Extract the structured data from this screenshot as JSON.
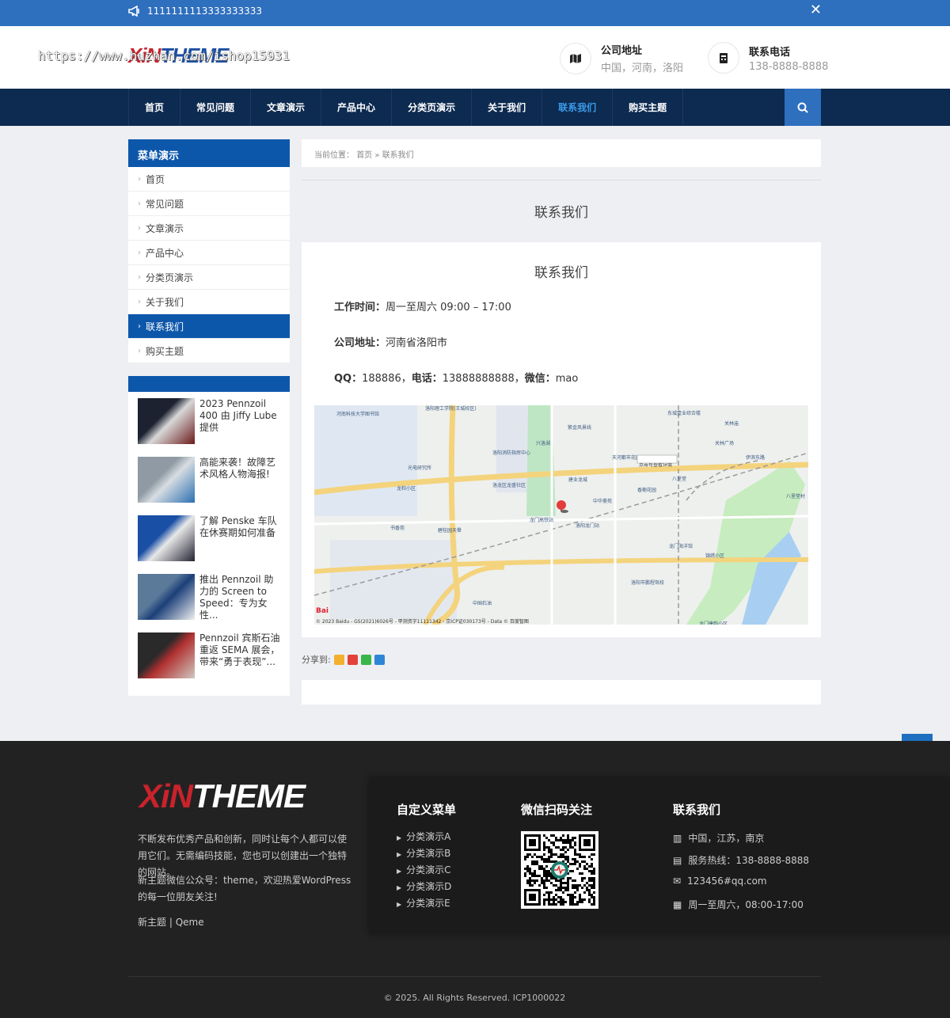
{
  "topbar": {
    "message": "1111111113333333333",
    "close_icon": "close-icon"
  },
  "header": {
    "logo": {
      "part1": "XiN",
      "part2": "THEME"
    },
    "watermark": "https://www.huzhan.com/ishop15931",
    "address": {
      "label": "公司地址",
      "value": "中国，河南，洛阳"
    },
    "phone": {
      "label": "联系电话",
      "value": "138-8888-8888"
    }
  },
  "nav": {
    "items": [
      "首页",
      "常见问题",
      "文章演示",
      "产品中心",
      "分类页演示",
      "关于我们",
      "联系我们",
      "购买主题"
    ],
    "active": "联系我们"
  },
  "sidebar": {
    "menu_title": "菜单演示",
    "menu": [
      "首页",
      "常见问题",
      "文章演示",
      "产品中心",
      "分类页演示",
      "关于我们",
      "联系我们",
      "购买主题"
    ],
    "posts": [
      {
        "title": "2023 Pennzoil 400 由 Jiffy Lube 提供"
      },
      {
        "title": "高能来袭！故障艺术风格人物海报!"
      },
      {
        "title": "了解 Penske 车队在休赛期如何准备"
      },
      {
        "title": "推出 Pennzoil 助力的 Screen to Speed：专为女性..."
      },
      {
        "title": "Pennzoil 宾斯石油重返 SEMA 展会，带来“勇于表现”..."
      }
    ]
  },
  "breadcrumb": {
    "prefix": "当前位置：",
    "home": "首页",
    "sep": "»",
    "current": "联系我们"
  },
  "page": {
    "title": "联系我们",
    "card_title": "联系我们",
    "work_label": "工作时间：",
    "work_value": "周一至周六 09:00 – 17:00",
    "addr_label": "公司地址：",
    "addr_value": "河南省洛阳市",
    "qq_label": "QQ：",
    "qq_value": "188886，",
    "tel_label": "电话：",
    "tel_value": "13888888888，",
    "wx_label": "微信：",
    "wx_value": "mao",
    "map_copyright": "© 2023 Baidu - GS(2021)6026号 - 甲测资字11111342 - 京ICP证030173号 - Data © 百度智图",
    "map_labels": [
      "河南科技大学图书馆",
      "洛阳理工学院(王城校区)",
      "兴洛湖",
      "紫金风景线",
      "东城壹业综合楼",
      "关林庙",
      "关林广场",
      "天河都市花园",
      "伊滨东路",
      "光电研究所",
      "洛阳消防指挥中心",
      "洛龙区龙盛社区",
      "建业龙城",
      "香榭花园",
      "八里堂",
      "龙和小区",
      "龙门高铁站",
      "洛阳龙门站",
      "八里堂村",
      "书香苑",
      "碧桂园天譽",
      "中华豪苑",
      "龙门海洋馆",
      "锦绣小区",
      "中国石油",
      "洛阳市鹏程驾校",
      "龙门康韵小区",
      "点击可查看详情"
    ]
  },
  "share": {
    "label": "分享到:"
  },
  "footer": {
    "logo": {
      "part1": "XiN",
      "part2": "THEME"
    },
    "desc1": "不断发布优秀产品和创新，同时让每个人都可以使用它们。无需编码技能，您也可以创建出一个独特的网站。",
    "desc2": "新主题微信公众号：theme，欢迎热爱WordPress的每一位朋友关注!",
    "links_left": "新主题",
    "links_sep": "|",
    "links_right": "Qeme",
    "menu_title": "自定义菜单",
    "menu": [
      "分类演示A",
      "分类演示B",
      "分类演示C",
      "分类演示D",
      "分类演示E"
    ],
    "wechat_title": "微信扫码关注",
    "contact_title": "联系我们",
    "contact": [
      "中国，江苏，南京",
      "服务热线：138-8888-8888",
      "123456#qq.com",
      "周一至周六，08:00-17:00"
    ],
    "copyright": "© 2025. All Rights Reserved. ICP1000022"
  },
  "colors": {
    "accent": "#0d57ab",
    "nav_bg": "#0d2a50",
    "topbar": "#2e6fbe",
    "footer_bg": "#222222"
  }
}
